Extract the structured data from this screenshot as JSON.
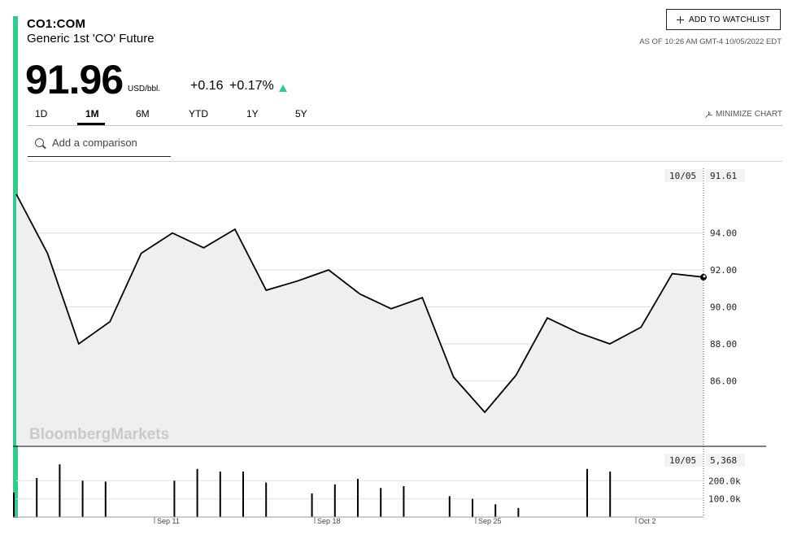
{
  "header": {
    "ticker": "CO1:COM",
    "name": "Generic 1st 'CO' Future",
    "price": "91.96",
    "unit": "USD/bbl.",
    "change": "+0.16",
    "change_pct": "+0.17%",
    "as_of": "AS OF 10:26 AM GMT-4 10/05/2022 EDT",
    "watchlist_label": "ADD TO WATCHLIST",
    "accent_color": "#2ecc8f",
    "positive_color": "#2ecc8f"
  },
  "tabs": [
    {
      "label": "1D",
      "active": false
    },
    {
      "label": "1M",
      "active": true
    },
    {
      "label": "6M",
      "active": false
    },
    {
      "label": "YTD",
      "active": false
    },
    {
      "label": "1Y",
      "active": false
    },
    {
      "label": "5Y",
      "active": false
    }
  ],
  "minimize_label": "MINIMIZE CHART",
  "search": {
    "placeholder": "Add a comparison"
  },
  "watermark": "BloombergMarkets",
  "chart_data": [
    {
      "type": "line",
      "series": [
        {
          "values": [
            96.1,
            92.9,
            88.0,
            89.2,
            92.9,
            94.0,
            93.2,
            94.2,
            90.9,
            91.4,
            92.0,
            90.7,
            89.9,
            90.5,
            86.2,
            84.3,
            86.3,
            89.4,
            88.6,
            88.0,
            88.9,
            91.8,
            91.61
          ]
        }
      ],
      "x_tick_labels": [
        "Sep 11",
        "Sep 18",
        "Sep 25",
        "Oct 2"
      ],
      "y_ticks": [
        86,
        88,
        90,
        92,
        94
      ],
      "y_tick_labels": [
        "86.00",
        "88.00",
        "90.00",
        "92.00",
        "94.00"
      ],
      "ylim": [
        82.5,
        97.5
      ],
      "grid": true,
      "last_value": {
        "date": "10/05",
        "value": "91.61"
      }
    },
    {
      "type": "bar",
      "series": [
        {
          "values": [
            135000,
            215000,
            290000,
            200000,
            195000,
            0,
            0,
            200000,
            265000,
            250000,
            250000,
            190000,
            0,
            130000,
            180000,
            210000,
            160000,
            170000,
            0,
            115000,
            100000,
            70000,
            50000,
            0,
            0,
            265000,
            250000
          ]
        }
      ],
      "y_ticks": [
        100000,
        200000
      ],
      "y_tick_labels": [
        "100.0k",
        "200.0k"
      ],
      "ylim": [
        0,
        340000
      ],
      "last_value": {
        "date": "10/05",
        "value": "5,368"
      }
    }
  ]
}
